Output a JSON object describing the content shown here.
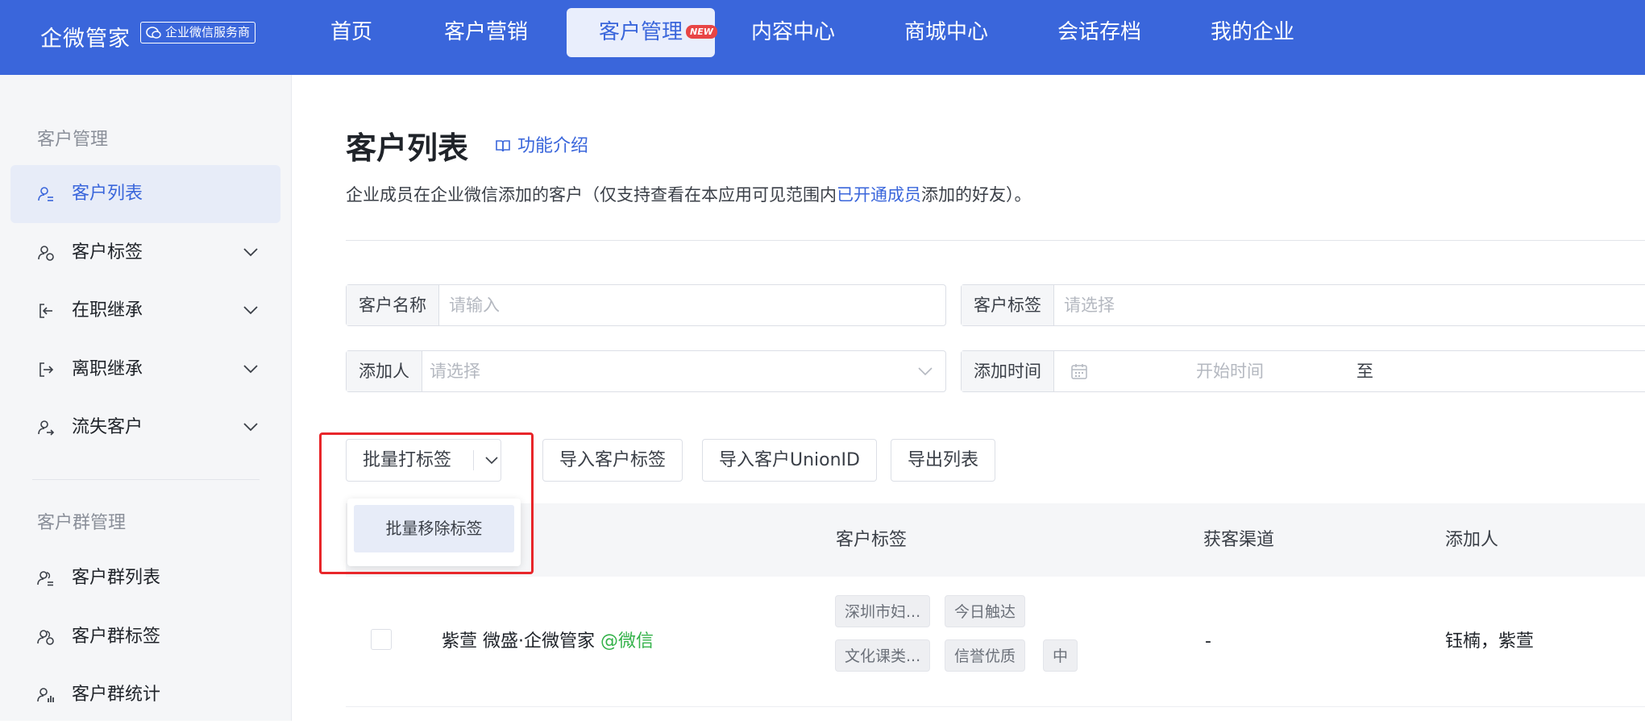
{
  "topnav": {
    "brand": "企微管家",
    "badge": "企业微信服务商",
    "items": [
      {
        "label": "首页"
      },
      {
        "label": "客户营销"
      },
      {
        "label": "客户管理",
        "badge": "NEW"
      },
      {
        "label": "内容中心"
      },
      {
        "label": "商城中心"
      },
      {
        "label": "会话存档"
      },
      {
        "label": "我的企业"
      }
    ]
  },
  "sidebar": {
    "group1": "客户管理",
    "items": [
      {
        "label": "客户列表",
        "icon": "user-list-icon"
      },
      {
        "label": "客户标签",
        "icon": "user-tag-icon"
      },
      {
        "label": "在职继承",
        "icon": "transfer-in-icon"
      },
      {
        "label": "离职继承",
        "icon": "transfer-out-icon"
      },
      {
        "label": "流失客户",
        "icon": "user-lost-icon"
      }
    ],
    "group2": "客户群管理",
    "items2": [
      {
        "label": "客户群列表",
        "icon": "group-list-icon"
      },
      {
        "label": "客户群标签",
        "icon": "group-tag-icon"
      },
      {
        "label": "客户群统计",
        "icon": "group-stats-icon"
      }
    ]
  },
  "main": {
    "title": "客户列表",
    "intro_link": "功能介绍",
    "desc_prefix": "企业成员在企业微信添加的客户（仅支持查看在本应用可见范围内",
    "desc_link": "已开通成员",
    "desc_suffix": "添加的好友）。"
  },
  "filters": {
    "name_label": "客户名称",
    "name_placeholder": "请输入",
    "tag_label": "客户标签",
    "tag_placeholder": "请选择",
    "adder_label": "添加人",
    "adder_placeholder": "请选择",
    "time_label": "添加时间",
    "time_start": "开始时间",
    "time_to": "至"
  },
  "actions": {
    "batch_tag": "批量打标签",
    "import_tags": "导入客户标签",
    "import_unionid": "导入客户UnionID",
    "export": "导出列表",
    "dropdown_item": "批量移除标签"
  },
  "table": {
    "headers": [
      "客户标签",
      "获客渠道",
      "添加人"
    ],
    "rows": [
      {
        "name": "紫萱 微盛·企微管家",
        "source_tag": "@微信",
        "tags": [
          "深圳市妇...",
          "今日触达",
          "文化课类...",
          "信誉优质",
          "中"
        ],
        "channel": "-",
        "adder": "钰楠，紫萱"
      }
    ]
  },
  "colors": {
    "primary": "#3a66db",
    "highlight": "#e8262a",
    "wechat_green": "#34b24a"
  }
}
